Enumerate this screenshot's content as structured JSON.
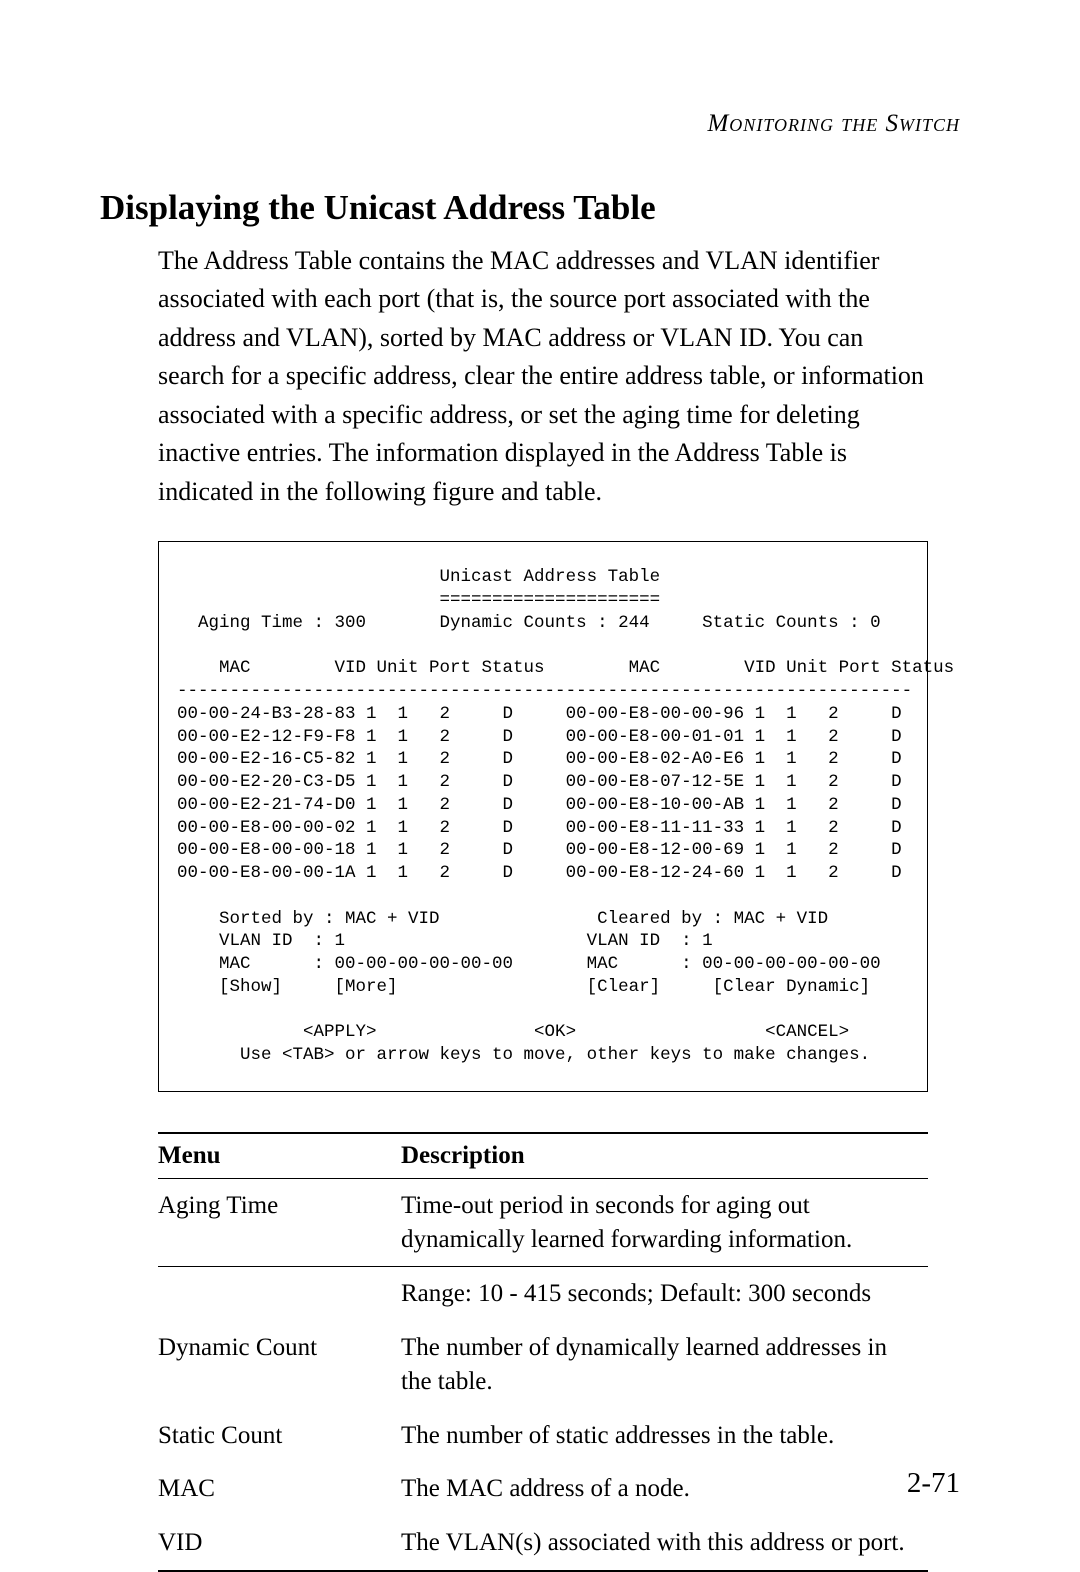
{
  "running_head": "Monitoring the Switch",
  "section_title": "Displaying the Unicast Address Table",
  "body_text": "The Address Table contains the MAC addresses and VLAN identifier associated with each port (that is, the source port associated with the address and VLAN), sorted by MAC address or VLAN ID. You can search for a specific address, clear the entire address table, or information associated with a specific address, or set the aging time for deleting inactive entries. The information displayed in the Address Table is indicated in the following figure and table.",
  "terminal": {
    "title": "Unicast Address Table",
    "divider": "=====================",
    "aging_label": "Aging Time :",
    "aging_value": "300",
    "dynamic_label": "Dynamic Counts :",
    "dynamic_value": "244",
    "static_label": "Static Counts :",
    "static_value": "0",
    "col_headers_left": "    MAC        VID Unit Port Status",
    "col_headers_right": "    MAC        VID Unit Port Status",
    "hrule": "----------------------------------------------------------------------",
    "rows": [
      {
        "l_mac": "00-00-24-B3-28-83",
        "l_vid": "1",
        "l_unit": "1",
        "l_port": "2",
        "l_status": "D",
        "r_mac": "00-00-E8-00-00-96",
        "r_vid": "1",
        "r_unit": "1",
        "r_port": "2",
        "r_status": "D"
      },
      {
        "l_mac": "00-00-E2-12-F9-F8",
        "l_vid": "1",
        "l_unit": "1",
        "l_port": "2",
        "l_status": "D",
        "r_mac": "00-00-E8-00-01-01",
        "r_vid": "1",
        "r_unit": "1",
        "r_port": "2",
        "r_status": "D"
      },
      {
        "l_mac": "00-00-E2-16-C5-82",
        "l_vid": "1",
        "l_unit": "1",
        "l_port": "2",
        "l_status": "D",
        "r_mac": "00-00-E8-02-A0-E6",
        "r_vid": "1",
        "r_unit": "1",
        "r_port": "2",
        "r_status": "D"
      },
      {
        "l_mac": "00-00-E2-20-C3-D5",
        "l_vid": "1",
        "l_unit": "1",
        "l_port": "2",
        "l_status": "D",
        "r_mac": "00-00-E8-07-12-5E",
        "r_vid": "1",
        "r_unit": "1",
        "r_port": "2",
        "r_status": "D"
      },
      {
        "l_mac": "00-00-E2-21-74-D0",
        "l_vid": "1",
        "l_unit": "1",
        "l_port": "2",
        "l_status": "D",
        "r_mac": "00-00-E8-10-00-AB",
        "r_vid": "1",
        "r_unit": "1",
        "r_port": "2",
        "r_status": "D"
      },
      {
        "l_mac": "00-00-E8-00-00-02",
        "l_vid": "1",
        "l_unit": "1",
        "l_port": "2",
        "l_status": "D",
        "r_mac": "00-00-E8-11-11-33",
        "r_vid": "1",
        "r_unit": "1",
        "r_port": "2",
        "r_status": "D"
      },
      {
        "l_mac": "00-00-E8-00-00-18",
        "l_vid": "1",
        "l_unit": "1",
        "l_port": "2",
        "l_status": "D",
        "r_mac": "00-00-E8-12-00-69",
        "r_vid": "1",
        "r_unit": "1",
        "r_port": "2",
        "r_status": "D"
      },
      {
        "l_mac": "00-00-E8-00-00-1A",
        "l_vid": "1",
        "l_unit": "1",
        "l_port": "2",
        "l_status": "D",
        "r_mac": "00-00-E8-12-24-60",
        "r_vid": "1",
        "r_unit": "1",
        "r_port": "2",
        "r_status": "D"
      }
    ],
    "sorted_by_label": "Sorted by :",
    "sorted_by_value": "MAC + VID",
    "cleared_by_label": "Cleared by :",
    "cleared_by_value": "MAC + VID",
    "vlan_id_label": "VLAN ID",
    "vlan_id_value_left": "1",
    "vlan_id_value_right": "1",
    "mac_label": "MAC",
    "mac_value_left": "00-00-00-00-00-00",
    "mac_value_right": "00-00-00-00-00-00",
    "btn_show": "[Show]",
    "btn_more": "[More]",
    "btn_clear": "[Clear]",
    "btn_clear_dynamic": "[Clear Dynamic]",
    "btn_apply": "<APPLY>",
    "btn_ok": "<OK>",
    "btn_cancel": "<CANCEL>",
    "hint": "Use <TAB> or arrow keys to move, other keys to make changes."
  },
  "menu_table": {
    "head_menu": "Menu",
    "head_desc": "Description",
    "rows": [
      {
        "menu": "Aging Time",
        "desc": "Time-out period in seconds for aging out dynamically learned forwarding information."
      },
      {
        "menu": "",
        "desc": "Range: 10 - 415 seconds; Default: 300 seconds",
        "range": true
      },
      {
        "menu": "Dynamic Count",
        "desc": "The number of dynamically learned addresses in the table."
      },
      {
        "menu": "Static Count",
        "desc": "The number of static addresses in the table."
      },
      {
        "menu": "MAC",
        "desc": "The MAC address of a node."
      },
      {
        "menu": "VID",
        "desc": "The VLAN(s) associated with this address or port.",
        "last": true
      }
    ]
  },
  "page_number": "2-71"
}
